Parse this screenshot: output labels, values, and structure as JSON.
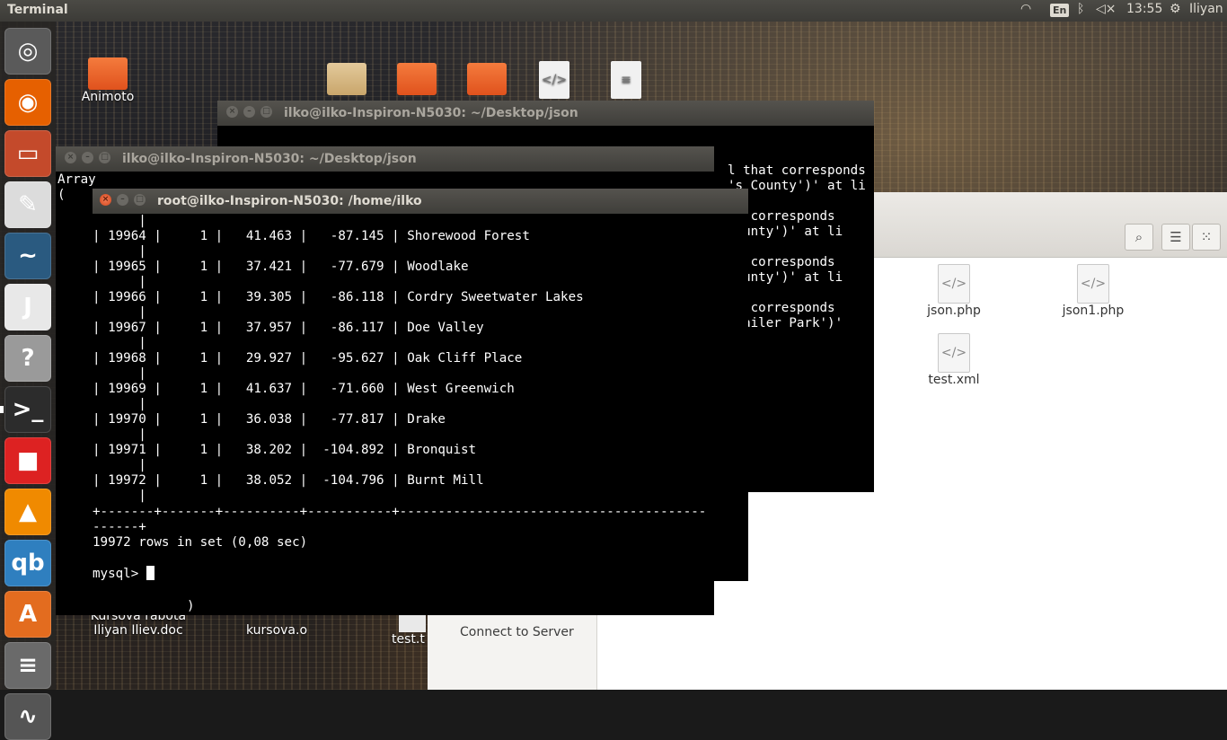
{
  "top_panel": {
    "app_title": "Terminal",
    "wifi_icon": "wifi-icon",
    "keyboard_layout": "En",
    "bluetooth_icon": "bluetooth-icon",
    "volume_icon": "volume-muted-icon",
    "clock": "13:55",
    "session_icon": "gear-icon",
    "user": "Iliyan"
  },
  "launcher": {
    "items": [
      {
        "name": "ubuntu-dash-icon",
        "glyph": "◎",
        "color": "#5a5a5a"
      },
      {
        "name": "firefox-icon",
        "glyph": "◉",
        "color": "#e66000"
      },
      {
        "name": "files-icon",
        "glyph": "▭",
        "color": "#c44a2b"
      },
      {
        "name": "text-editor-icon",
        "glyph": "✎",
        "color": "#dcdcdc"
      },
      {
        "name": "mysql-workbench-icon",
        "glyph": "~",
        "color": "#2a5a80"
      },
      {
        "name": "jdownloader-icon",
        "glyph": "J",
        "color": "#e8e8e8"
      },
      {
        "name": "help-icon",
        "glyph": "?",
        "color": "#9a9a9a"
      },
      {
        "name": "terminal-icon",
        "glyph": ">_",
        "color": "#2c2c2c"
      },
      {
        "name": "app-grid-icon",
        "glyph": "■",
        "color": "#d22"
      },
      {
        "name": "vlc-icon",
        "glyph": "▲",
        "color": "#f08a00"
      },
      {
        "name": "qbittorrent-icon",
        "glyph": "qb",
        "color": "#2f7fbf"
      },
      {
        "name": "software-center-icon",
        "glyph": "A",
        "color": "#e36c1f"
      },
      {
        "name": "workspaces-icon",
        "glyph": "≡",
        "color": "#6a6a6a"
      },
      {
        "name": "system-monitor-icon",
        "glyph": "∿",
        "color": "#555"
      }
    ]
  },
  "desktop": {
    "animoto_label": "Animoto",
    "kursova_doc_line1": "Kursova rabota",
    "kursova_doc_line2": "Iliyan Iliev.doc",
    "kursova_o_label": "kursova.o",
    "test_label": "test.t"
  },
  "file_manager": {
    "search_icon": "search-icon",
    "list_view_icon": "list-view-icon",
    "grid_view_icon": "grid-view-icon",
    "connect_to_server": "Connect to Server",
    "files": [
      {
        "name": "json.php"
      },
      {
        "name": "json1.php"
      },
      {
        "name": "test.xml"
      }
    ]
  },
  "terminal_back": {
    "title": "ilko@ilko-Inspiron-N5030: ~/Desktop/json",
    "lines": [
      "l that corresponds",
      "'s County')' at li",
      "",
      "nt corresponds",
      "County')' at li",
      "",
      "nt corresponds",
      "County')' at li",
      "",
      "nt corresponds",
      "Trailer Park')'"
    ]
  },
  "terminal_mid": {
    "title": "ilko@ilko-Inspiron-N5030: ~/Desktop/json",
    "line1": "Array",
    "line2": "(",
    "line_last": ")"
  },
  "terminal_front": {
    "title": "root@ilko-Inspiron-N5030: /home/ilko",
    "rows": [
      {
        "id": "19964",
        "n": "1",
        "lat": "41.463",
        "lng": "-87.145",
        "name": "Shorewood Forest"
      },
      {
        "id": "19965",
        "n": "1",
        "lat": "37.421",
        "lng": "-77.679",
        "name": "Woodlake"
      },
      {
        "id": "19966",
        "n": "1",
        "lat": "39.305",
        "lng": "-86.118",
        "name": "Cordry Sweetwater Lakes"
      },
      {
        "id": "19967",
        "n": "1",
        "lat": "37.957",
        "lng": "-86.117",
        "name": "Doe Valley"
      },
      {
        "id": "19968",
        "n": "1",
        "lat": "29.927",
        "lng": "-95.627",
        "name": "Oak Cliff Place"
      },
      {
        "id": "19969",
        "n": "1",
        "lat": "41.637",
        "lng": "-71.660",
        "name": "West Greenwich"
      },
      {
        "id": "19970",
        "n": "1",
        "lat": "36.038",
        "lng": "-77.817",
        "name": "Drake"
      },
      {
        "id": "19971",
        "n": "1",
        "lat": "38.202",
        "lng": "-104.892",
        "name": "Bronquist"
      },
      {
        "id": "19972",
        "n": "1",
        "lat": "38.052",
        "lng": "-104.796",
        "name": "Burnt Mill"
      }
    ],
    "row_continuation": "      |",
    "border_line": "+-------+-------+----------+-----------+----------------------------------------",
    "border_tail": "------+",
    "summary": "19972 rows in set (0,08 sec)",
    "prompt": "mysql> "
  }
}
